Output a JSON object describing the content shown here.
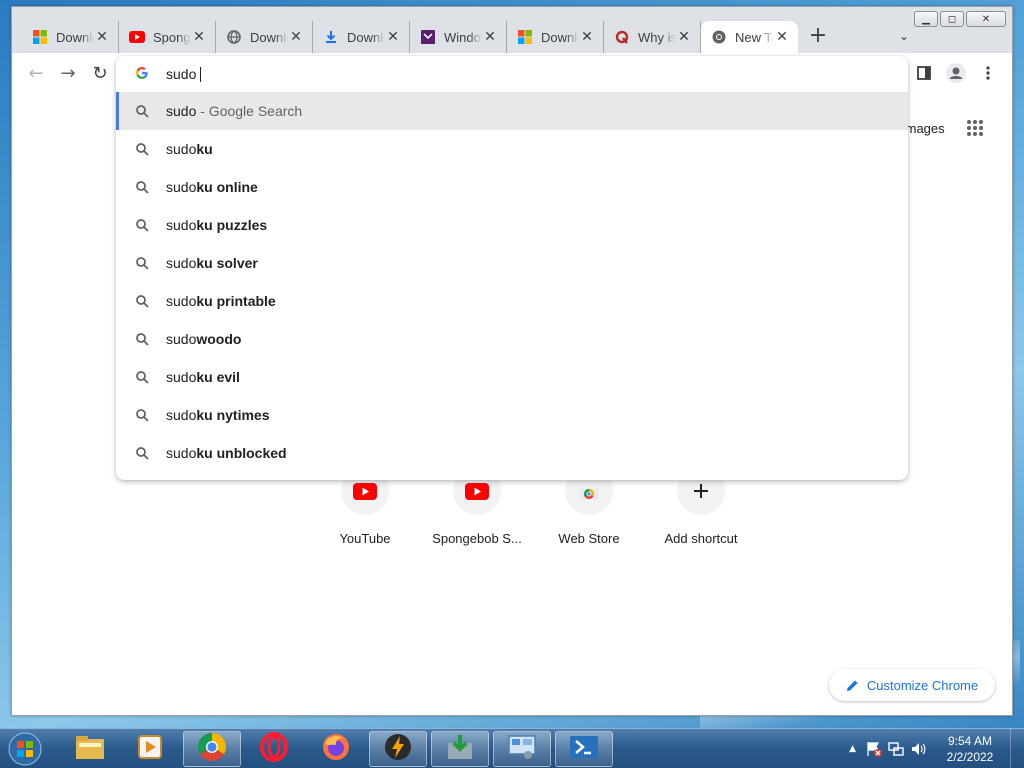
{
  "browser": {
    "window_controls": {
      "minimize": "▁",
      "maximize": "◻",
      "close": "✕"
    },
    "tabs": [
      {
        "title": "Download",
        "icon": "microsoft-icon",
        "active": false
      },
      {
        "title": "Spongebob",
        "icon": "youtube-icon",
        "active": false
      },
      {
        "title": "Download",
        "icon": "globe-icon",
        "active": false
      },
      {
        "title": "Download",
        "icon": "download-icon",
        "active": false
      },
      {
        "title": "Windows",
        "icon": "windows-purple-icon",
        "active": false
      },
      {
        "title": "Download",
        "icon": "microsoft-icon",
        "active": false
      },
      {
        "title": "Why is",
        "icon": "quora-icon",
        "active": false
      },
      {
        "title": "New Tab",
        "icon": "chrome-icon",
        "active": true
      }
    ],
    "tab_close": "✕",
    "new_tab": "+",
    "tab_search": "⌄",
    "nav": {
      "back": "←",
      "forward": "→",
      "reload": "↻"
    },
    "omnibox": {
      "query": "sudo",
      "suggestions": [
        {
          "typed": "sudo",
          "rest": "",
          "suffix": " - Google Search",
          "selected": true
        },
        {
          "typed": "sudo",
          "rest": "ku"
        },
        {
          "typed": "sudo",
          "rest": "ku online"
        },
        {
          "typed": "sudo",
          "rest": "ku puzzles"
        },
        {
          "typed": "sudo",
          "rest": "ku solver"
        },
        {
          "typed": "sudo",
          "rest": "ku printable"
        },
        {
          "typed": "sudo",
          "rest": "woodo"
        },
        {
          "typed": "sudo",
          "rest": "ku evil"
        },
        {
          "typed": "sudo",
          "rest": "ku nytimes"
        },
        {
          "typed": "sudo",
          "rest": "ku unblocked"
        }
      ]
    },
    "page": {
      "images_link": "Images",
      "shortcuts": [
        {
          "label": "YouTube",
          "icon": "youtube-icon"
        },
        {
          "label": "Spongebob S...",
          "icon": "youtube-icon"
        },
        {
          "label": "Web Store",
          "icon": "chrome-web-store-icon"
        },
        {
          "label": "Add shortcut",
          "icon": "plus-icon"
        }
      ],
      "customize_label": "Customize Chrome"
    }
  },
  "taskbar": {
    "apps": [
      "file-explorer-icon",
      "media-player-icon",
      "chrome-icon",
      "opera-icon",
      "firefox-icon",
      "winamp-icon",
      "download-manager-icon",
      "control-panel-icon",
      "powershell-icon"
    ],
    "clock_time": "9:54 AM",
    "clock_date": "2/2/2022"
  },
  "colors": {
    "accent": "#1a73e8",
    "selection_bar": "#4e7be0"
  }
}
